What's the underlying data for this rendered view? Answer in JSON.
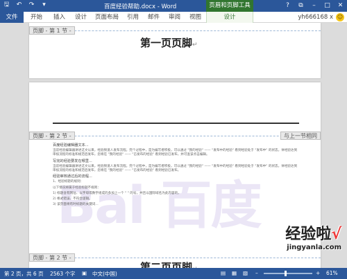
{
  "titlebar": {
    "title": "百度经验帮助.docx - Word",
    "context_group": "页眉和页脚工具",
    "qat": {
      "save": "🖫",
      "undo": "↶",
      "redo": "↷",
      "customize": "▾"
    },
    "window_controls": {
      "help": "?",
      "restore": "⧉",
      "minimize": "–",
      "maximize": "□",
      "close": "✕"
    }
  },
  "ribbon": {
    "file_tab": "文件",
    "tabs": [
      "开始",
      "插入",
      "设计",
      "页面布局",
      "引用",
      "邮件",
      "审阅",
      "视图"
    ],
    "context_tab": "设计",
    "user": "yh666168 x",
    "user_icon": "smile-icon"
  },
  "page1": {
    "footer_tag": "页脚 - 第 1 节 -",
    "footer_text": "第一页页脚",
    "pilcrow": "↵"
  },
  "page2": {
    "header_tag": "页脚 - 第 2 节 -",
    "same_as_previous": "与上一节相同",
    "footer_tag": "页脚 - 第 2 节 -",
    "footer_text": "第二页页脚",
    "pilcrow": "↵",
    "body": [
      "百度经验编辑器文本...",
      "当前经验编辑器讲述这文以来，经验频道人发布流程。完个过程中，是为编写者积极，可以通过 \"我的经验\" —— \"发布中的经验\" 看到经验处于 \"发布中\" 的状态。体经验达到审核流程的标准和规范后发布，您将在 \"我的经验\" —— \"已发布的经验\" 看到经验已发布，并可查该点击编辑。",
      "写完的经验要发在哪里...",
      "当前经验编辑器讲述这文以来，经验频道人发布流程。完个过程中，是为编写者积极，可以通过 \"我的经验\" —— \"发布中的经验\" 看到经验处于 \"发布中\" 的状态。体经验达到审核流程的标准和规范后发布，您将在 \"我的经验\" —— \"已发布的经验\" 看到经验已发布。",
      "经验审核通过后的流程...",
      "1、经验标题的规则：",
      "以下情况将属于经验标题不规则：",
      "1) 标题含有网址、以字母或数字组成的多加上一个 \" \" 的号，并且以国际域名为此内容的，",
      "2) 格式错误、不符合逻辑。",
      "3) 该页面将有时标题的关键词..."
    ],
    "watermark": "Bai 百度",
    "watermark_paw": "🐾"
  },
  "overlay": {
    "brand": "经验啦",
    "brand_check": "√",
    "url": "jingyanla.com"
  },
  "statusbar": {
    "page": "第 2 页，共 6 页",
    "words": "2563 个字",
    "proofing_icon": "proofing-icon",
    "language": "中文(中国)",
    "zoom": "61%",
    "zoom_value": 0.61
  }
}
